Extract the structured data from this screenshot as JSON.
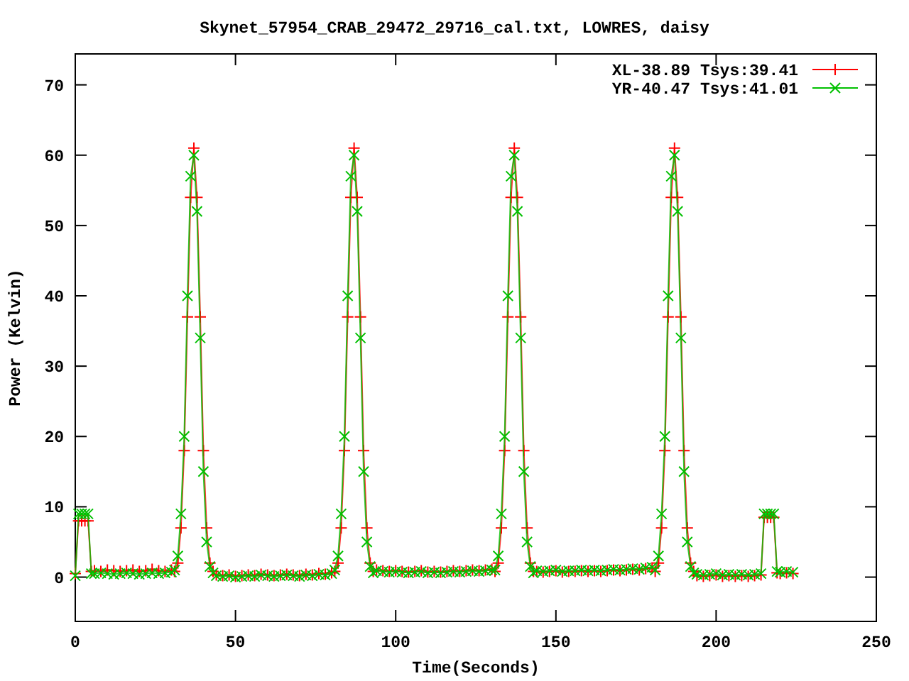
{
  "chart": {
    "chart_data": {
      "type": "line",
      "title": "Skynet_57954_CRAB_29472_29716_cal.txt, LOWRES, daisy",
      "xlabel": "Time(Seconds)",
      "ylabel": "Power (Kelvin)",
      "xlim": [
        0,
        250
      ],
      "ylim": [
        -6.3,
        74.4
      ],
      "xticks": [
        0,
        50,
        100,
        150,
        200,
        250
      ],
      "yticks": [
        0,
        10,
        20,
        30,
        40,
        50,
        60,
        70
      ],
      "legend": true,
      "x": [
        0,
        1,
        2,
        3,
        4,
        5,
        6,
        8,
        10,
        12,
        14,
        16,
        18,
        20,
        22,
        24,
        26,
        28,
        30,
        31,
        32,
        33,
        34,
        35,
        36,
        37,
        38,
        39,
        40,
        41,
        42,
        43,
        44,
        46,
        48,
        50,
        52,
        54,
        56,
        58,
        60,
        62,
        64,
        66,
        68,
        70,
        72,
        74,
        76,
        78,
        80,
        81,
        82,
        83,
        84,
        85,
        86,
        87,
        88,
        89,
        90,
        91,
        92,
        93,
        94,
        96,
        98,
        100,
        102,
        104,
        106,
        108,
        110,
        112,
        114,
        116,
        118,
        120,
        122,
        124,
        126,
        128,
        130,
        131,
        132,
        133,
        134,
        135,
        136,
        137,
        138,
        139,
        140,
        141,
        142,
        143,
        144,
        146,
        148,
        150,
        152,
        154,
        156,
        158,
        160,
        162,
        164,
        166,
        168,
        170,
        172,
        174,
        176,
        178,
        180,
        181,
        182,
        183,
        184,
        185,
        186,
        187,
        188,
        189,
        190,
        191,
        192,
        193,
        194,
        196,
        198,
        200,
        202,
        204,
        206,
        208,
        210,
        212,
        214,
        215,
        216,
        217,
        218,
        219,
        220,
        222,
        224
      ],
      "series": [
        {
          "name": "XL-38.89 Tsys:39.41",
          "color": "#ff0000",
          "marker": "plus",
          "values": [
            0.5,
            8,
            8,
            8,
            8,
            0.8,
            0.9,
            0.8,
            1,
            0.9,
            0.8,
            0.9,
            1,
            0.8,
            0.9,
            1.1,
            0.9,
            0.8,
            1,
            0.8,
            2,
            7,
            18,
            37,
            54,
            61,
            54,
            37,
            18,
            7,
            2,
            0.8,
            0.3,
            0.2,
            0.3,
            0.1,
            0.2,
            0.3,
            0.2,
            0.4,
            0.3,
            0.2,
            0.3,
            0.4,
            0.3,
            0.2,
            0.4,
            0.3,
            0.5,
            0.4,
            0.6,
            0.8,
            2,
            7,
            18,
            37,
            54,
            61,
            54,
            37,
            18,
            7,
            2,
            0.8,
            1,
            0.9,
            0.8,
            0.9,
            0.8,
            0.7,
            0.8,
            0.9,
            0.7,
            0.8,
            0.7,
            0.8,
            0.9,
            0.8,
            0.9,
            1,
            0.9,
            1,
            1.1,
            0.8,
            2,
            7,
            18,
            37,
            54,
            61,
            54,
            37,
            18,
            7,
            2,
            0.8,
            0.8,
            0.7,
            0.8,
            0.9,
            0.7,
            0.8,
            0.8,
            0.9,
            0.8,
            0.9,
            0.8,
            0.9,
            1,
            0.9,
            1,
            1.1,
            1,
            1.2,
            1.3,
            0.8,
            2,
            7,
            18,
            37,
            54,
            61,
            54,
            37,
            18,
            7,
            2,
            0.8,
            0.2,
            0.1,
            0.2,
            0.3,
            0.1,
            0.2,
            0.1,
            0.2,
            0.1,
            0.2,
            0.3,
            8.5,
            8.5,
            8.5,
            8.5,
            0.6,
            0.5,
            0.6,
            0.5
          ]
        },
        {
          "name": "YR-40.47 Tsys:41.01",
          "color": "#00c000",
          "marker": "cross",
          "values": [
            0.2,
            9,
            9,
            9,
            9,
            0.5,
            0.5,
            0.6,
            0.5,
            0.4,
            0.5,
            0.6,
            0.5,
            0.4,
            0.5,
            0.6,
            0.5,
            0.6,
            0.7,
            1,
            3,
            9,
            20,
            40,
            57,
            60,
            52,
            34,
            15,
            5,
            1.5,
            0.6,
            0.2,
            0.1,
            0.2,
            0,
            0.1,
            0.2,
            0.1,
            0.3,
            0.2,
            0.1,
            0.2,
            0.3,
            0.2,
            0.1,
            0.3,
            0.2,
            0.4,
            0.3,
            0.5,
            1,
            3,
            9,
            20,
            40,
            57,
            60,
            52,
            34,
            15,
            5,
            1.5,
            0.6,
            0.9,
            0.8,
            0.7,
            0.8,
            0.7,
            0.6,
            0.7,
            0.8,
            0.6,
            0.7,
            0.6,
            0.7,
            0.8,
            0.7,
            0.8,
            0.9,
            0.8,
            0.9,
            1,
            1,
            3,
            9,
            20,
            40,
            57,
            60,
            52,
            34,
            15,
            5,
            1.5,
            0.6,
            0.9,
            0.8,
            0.9,
            1,
            0.8,
            0.9,
            0.9,
            1,
            0.9,
            1,
            0.9,
            1,
            1.1,
            1,
            1.1,
            1.2,
            1.1,
            1.3,
            1.4,
            1,
            3,
            9,
            20,
            40,
            57,
            60,
            52,
            34,
            15,
            5,
            1.5,
            0.6,
            0.4,
            0.3,
            0.4,
            0.5,
            0.3,
            0.4,
            0.3,
            0.4,
            0.3,
            0.4,
            0.5,
            9,
            9,
            9,
            9,
            0.8,
            0.7,
            0.8,
            0.7
          ]
        }
      ]
    }
  }
}
